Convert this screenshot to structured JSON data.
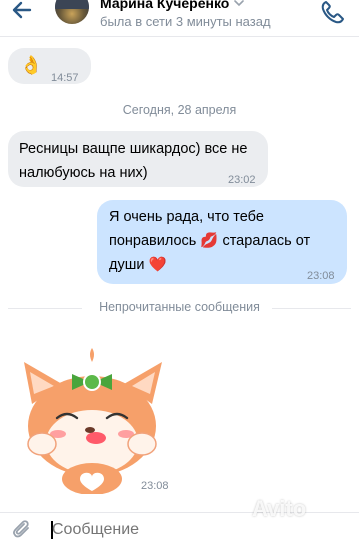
{
  "header": {
    "contact_name": "Марина Кучеренко",
    "status": "была в сети 3 минуты назад"
  },
  "messages": [
    {
      "emoji": "👌",
      "time": "14:57"
    },
    {
      "text": "Ресницы ващпе шикардос) все не налюбуюсь на них)",
      "time": "23:02"
    },
    {
      "text": "Я очень рада, что тебе понравилось 💋 старалась от души ❤️",
      "time": "23:08"
    }
  ],
  "date_separator": "Сегодня, 28 апреля",
  "unread_separator": "Непрочитанные сообщения",
  "sticker_time": "23:08",
  "composer": {
    "placeholder": "Сообщение"
  },
  "watermark": "Avito",
  "colors": {
    "accent": "#2a5885",
    "incoming": "#ebedf0",
    "outgoing": "#cce4ff",
    "muted": "#818c99",
    "sticker_orange": "#f6a06a"
  }
}
